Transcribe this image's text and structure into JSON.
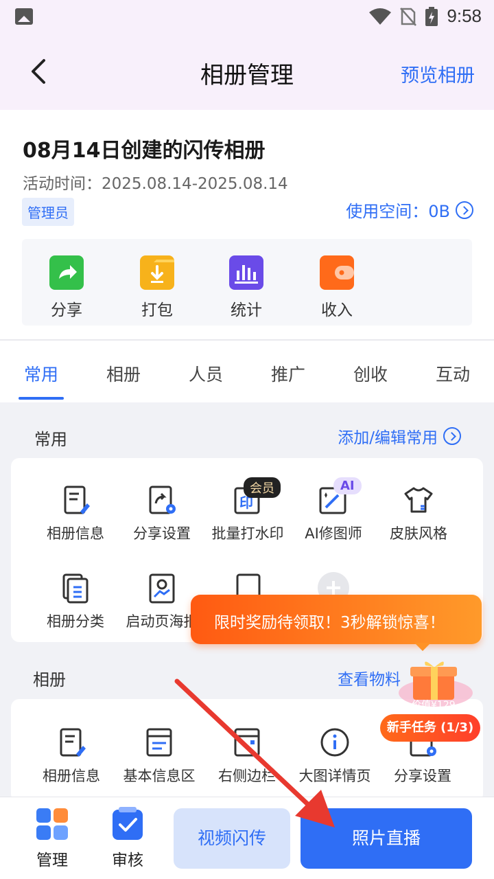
{
  "status_bar": {
    "time": "9:58"
  },
  "header": {
    "title": "相册管理",
    "preview_link": "预览相册"
  },
  "album": {
    "title": "08月14日创建的闪传相册",
    "activity_time": "活动时间：2025.08.14-2025.08.14",
    "role_badge": "管理员",
    "space_usage": "使用空间：0B"
  },
  "quick_actions": [
    {
      "label": "分享",
      "icon": "share-icon",
      "color": "#34c04a"
    },
    {
      "label": "打包",
      "icon": "package-download-icon",
      "color": "#f7b21b"
    },
    {
      "label": "统计",
      "icon": "statistics-icon",
      "color": "#6a4be8"
    },
    {
      "label": "收入",
      "icon": "wallet-icon",
      "color": "#ff6a1a"
    }
  ],
  "tabs": [
    "常用",
    "相册",
    "人员",
    "推广",
    "创收",
    "互动"
  ],
  "common_section": {
    "title": "常用",
    "link": "添加/编辑常用",
    "items": [
      {
        "label": "相册信息",
        "icon": "album-info-icon"
      },
      {
        "label": "分享设置",
        "icon": "share-settings-icon"
      },
      {
        "label": "批量打水印",
        "icon": "watermark-icon"
      },
      {
        "label": "AI修图师",
        "icon": "ai-retouch-icon"
      },
      {
        "label": "皮肤风格",
        "icon": "skin-style-icon"
      },
      {
        "label": "相册分类",
        "icon": "album-category-icon"
      },
      {
        "label": "启动页海报",
        "icon": "launch-poster-icon"
      }
    ],
    "vip_badge": "会员",
    "ai_badge": "AI"
  },
  "album_section": {
    "title": "相册",
    "link": "查看物料",
    "items": [
      {
        "label": "相册信息",
        "icon": "album-info-icon"
      },
      {
        "label": "基本信息区",
        "icon": "basic-info-icon"
      },
      {
        "label": "右侧边栏",
        "icon": "right-sidebar-icon"
      },
      {
        "label": "大图详情页",
        "icon": "info-icon"
      },
      {
        "label": "分享设置",
        "icon": "share-settings-icon"
      }
    ]
  },
  "promo": {
    "text": "限时奖励待领取！3秒解锁惊喜！",
    "gift_value": "价值¥129",
    "task": "新手任务 (1/3)"
  },
  "bottom_bar": {
    "manage": "管理",
    "review": "审核",
    "video_button": "视频闪传",
    "photo_button": "照片直播"
  },
  "colors": {
    "accent": "#2f6ef5",
    "promo": "#ff6a1a",
    "arrow": "#e8392f"
  }
}
